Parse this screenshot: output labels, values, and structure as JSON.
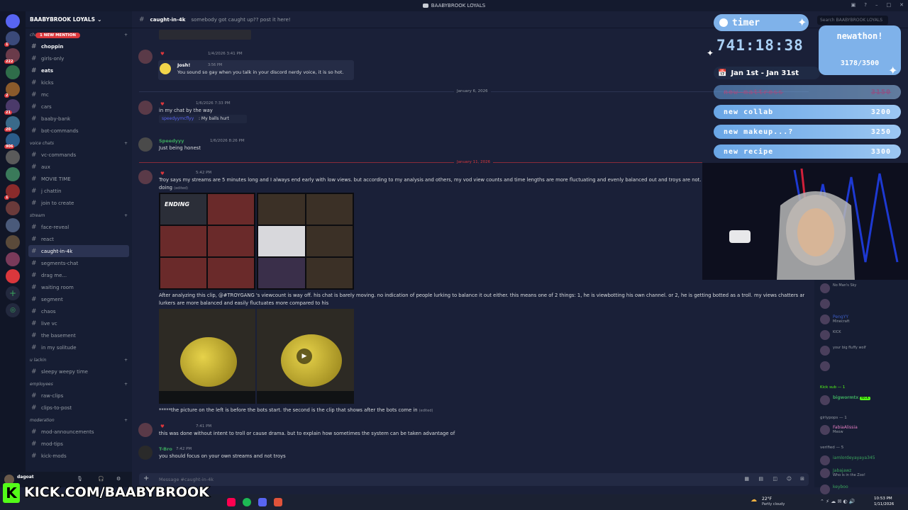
{
  "window": {
    "title": "BAABYBROOK LOYALS"
  },
  "server": {
    "name": "BAABYBROOK LOYALS",
    "new_mention": "1 NEW MENTION"
  },
  "rail_badges": [
    "1",
    "222",
    "2",
    "21",
    "20",
    "906",
    "1"
  ],
  "channels": [
    {
      "type": "cat",
      "label": "chats"
    },
    {
      "type": "ch",
      "label": "choppin",
      "unread": true
    },
    {
      "type": "ch",
      "label": "girls-only"
    },
    {
      "type": "ch",
      "label": "eats",
      "unread": true
    },
    {
      "type": "ch",
      "label": "kicks"
    },
    {
      "type": "ch",
      "label": "mc"
    },
    {
      "type": "ch",
      "label": "cars"
    },
    {
      "type": "ch",
      "label": "baaby-bank"
    },
    {
      "type": "ch",
      "label": "bot-commands"
    },
    {
      "type": "cat",
      "label": "voice chats"
    },
    {
      "type": "ch",
      "label": "vc-commands"
    },
    {
      "type": "ch",
      "label": "aux"
    },
    {
      "type": "ch",
      "label": "MOVIE TIME"
    },
    {
      "type": "ch",
      "label": "j chattin"
    },
    {
      "type": "ch",
      "label": "join to create"
    },
    {
      "type": "cat",
      "label": "stream"
    },
    {
      "type": "ch",
      "label": "face-reveal"
    },
    {
      "type": "ch",
      "label": "react"
    },
    {
      "type": "ch",
      "label": "caught-in-4k",
      "active": true
    },
    {
      "type": "ch",
      "label": "segments-chat"
    },
    {
      "type": "ch",
      "label": "drag me..."
    },
    {
      "type": "ch",
      "label": "waiting room"
    },
    {
      "type": "ch",
      "label": "segment"
    },
    {
      "type": "ch",
      "label": "chaos"
    },
    {
      "type": "ch",
      "label": "live vc"
    },
    {
      "type": "ch",
      "label": "the basement"
    },
    {
      "type": "ch",
      "label": "in my solitude"
    },
    {
      "type": "cat",
      "label": "u lackin"
    },
    {
      "type": "ch",
      "label": "sleepy weepy time"
    },
    {
      "type": "cat",
      "label": "employees"
    },
    {
      "type": "ch",
      "label": "raw-clips"
    },
    {
      "type": "ch",
      "label": "clips-to-post"
    },
    {
      "type": "cat",
      "label": "moderation"
    },
    {
      "type": "ch",
      "label": "mod-announcements"
    },
    {
      "type": "ch",
      "label": "mod-tips"
    },
    {
      "type": "ch",
      "label": "kick-mods"
    }
  ],
  "header": {
    "channel": "caught-in-4k",
    "topic": "somebody got caught up?? post it here!",
    "search_placeholder": "Search BAABYBROOK LOYALS"
  },
  "messages": {
    "m1_ts": "1/4/2026 3:41 PM",
    "reply_name": "Josh!",
    "reply_ts": "3:56 PM",
    "reply_text": "You sound so gay when you talk in your discord nerdy voice, it is so hot.",
    "date1": "January 6, 2026",
    "m2_ts": "1/6/2026 7:33 PM",
    "m2_text": "in my chat by the way",
    "m2_quote_name": "speedyymcflyy",
    "m2_quote_text": ": My balls hurt",
    "m3_name": "Speedyyy",
    "m3_ts": "1/6/2026 8:26 PM",
    "m3_text": "Just being honest",
    "date2": "January 11, 2026",
    "m4_ts": "5:42 PM",
    "m4_text": "Troy says my streams are 5 minutes long and I always end early with low views. but according to my analysis and others, my vod view counts and time lengths are more fluctuating and evenly balanced out and troys are not. somet",
    "m4_text2": "doing",
    "edited": "(edited)",
    "grid_ending": "ENDING",
    "m4_text3": "After analyzing this clip, @#TROYGANG 's viewcount is way off. his chat is barely moving. no indication of people lurking to balance it out either. this means one of 2 things: 1, he is viewbotting his own channel. or 2, he is getting botted as a troll. my views chatters and",
    "m4_text4": "lurkers are more balanced and easily fluctuates more compared to his",
    "m4_text5": "*****the picture on the left is before the bots start. the second is the clip that shows after the bots come in",
    "m5_ts": "7:41 PM",
    "m5_text": "this was done without intent to troll or cause drama. but to explain how sometimes the system can be taken advantage of",
    "m6_name": "T-Bro",
    "m6_ts": "7:42 PM",
    "m6_text": "you should focus on your own streams and not troys"
  },
  "composer": {
    "placeholder": "Message #caught-in-4k"
  },
  "user_panel": {
    "name": "dagoat"
  },
  "overlay": {
    "timer_label": "timer",
    "timer_value": "741:18:38",
    "date_range": "Jan 1st - Jan 31st",
    "newathon": "newathon!",
    "newathon_count": "3178/3500",
    "goals": [
      {
        "label": "new mattress",
        "value": "3150",
        "done": true
      },
      {
        "label": "new collab",
        "value": "3200"
      },
      {
        "label": "new makeup...?",
        "value": "3250"
      },
      {
        "label": "new recipe",
        "value": "3300"
      }
    ],
    "kick_url": "KICK.COM/BAABYBROOK"
  },
  "members": {
    "cat_kick": "Kick sub — 1",
    "kick_member": "bigwormtx",
    "kick_tag": "KICK",
    "cat_girlypops": "girlypops — 1",
    "girlypop_name": "FabiaAlissia",
    "girlypop_status": "Meow",
    "cat_verified": "verified — 5",
    "verified": [
      "iamlordeyayaya345",
      "Jabajawz",
      "Who is in the Zoo!",
      "keyboo"
    ],
    "top": [
      {
        "name": "",
        "status": "No Man's Sky"
      },
      {
        "name": "",
        "status": ""
      },
      {
        "name": "PengYY",
        "status": "Minecraft"
      },
      {
        "name": "",
        "status": "KICK"
      },
      {
        "name": "",
        "status": "your big fluffy wolf"
      },
      {
        "name": "",
        "status": ""
      }
    ]
  },
  "taskbar": {
    "weather": "22°F",
    "weather_desc": "Partly cloudy",
    "time": "10:53 PM",
    "date": "1/11/2026"
  },
  "colors": {
    "accent": "#5865f2",
    "mention_red": "#da373c",
    "kick_green": "#53fc18",
    "timer_blue": "#7fb2ea"
  }
}
